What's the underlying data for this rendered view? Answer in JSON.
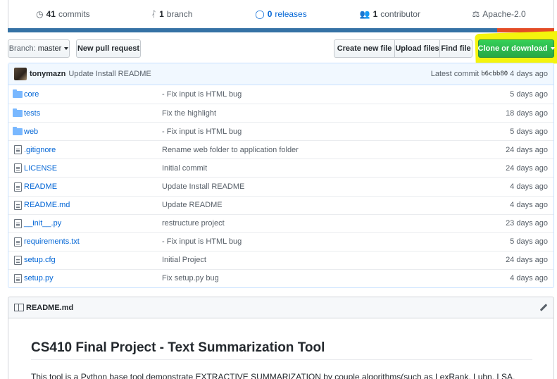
{
  "summary": {
    "commits_count": "41",
    "commits_label": "commits",
    "branch_count": "1",
    "branch_label": "branch",
    "releases_count": "0",
    "releases_label": "releases",
    "contributor_count": "1",
    "contributor_label": "contributor",
    "license": "Apache-2.0"
  },
  "languages": {
    "python_color": "#3572A5",
    "html_color": "#e34c26"
  },
  "toolbar": {
    "branch_label": "Branch:",
    "branch_value": "master",
    "new_pull_request": "New pull request",
    "create_new_file": "Create new file",
    "upload_files": "Upload files",
    "find_file": "Find file",
    "clone_or_download": "Clone or download"
  },
  "latest_commit": {
    "author": "tonymazn",
    "message": "Update Install README",
    "label": "Latest commit",
    "sha": "b6cbb80",
    "age": "4 days ago"
  },
  "files": [
    {
      "type": "folder",
      "icon": "folder-icon",
      "name": "core",
      "message": "- Fix input is HTML bug",
      "age": "5 days ago"
    },
    {
      "type": "folder",
      "icon": "folder-icon",
      "name": "tests",
      "message": "Fix the highlight",
      "age": "18 days ago"
    },
    {
      "type": "folder",
      "icon": "folder-icon",
      "name": "web",
      "message": "- Fix input is HTML bug",
      "age": "5 days ago"
    },
    {
      "type": "file",
      "icon": "file-icon",
      "name": ".gitignore",
      "message": "Rename web folder to application folder",
      "age": "24 days ago"
    },
    {
      "type": "file",
      "icon": "file-icon",
      "name": "LICENSE",
      "message": "Initial commit",
      "age": "24 days ago"
    },
    {
      "type": "file",
      "icon": "file-icon",
      "name": "README",
      "message": "Update Install README",
      "age": "4 days ago"
    },
    {
      "type": "file",
      "icon": "file-icon",
      "name": "README.md",
      "message": "Update README",
      "age": "4 days ago"
    },
    {
      "type": "file",
      "icon": "file-icon",
      "name": "__init__.py",
      "message": "restructure project",
      "age": "23 days ago"
    },
    {
      "type": "file",
      "icon": "file-icon",
      "name": "requirements.txt",
      "message": "- Fix input is HTML bug",
      "age": "5 days ago"
    },
    {
      "type": "file",
      "icon": "file-icon",
      "name": "setup.cfg",
      "message": "Initial Project",
      "age": "24 days ago"
    },
    {
      "type": "file",
      "icon": "file-icon",
      "name": "setup.py",
      "message": "Fix setup.py bug",
      "age": "4 days ago"
    }
  ],
  "readme": {
    "filename": "README.md",
    "heading": "CS410 Final Project - Text Summarization Tool",
    "intro": "This tool is a Python base tool demonstrate EXTRACTIVE SUMMARIZATION by couple algorithms(such as LexRank, Luhn, LSA,"
  },
  "colors": {
    "link": "#0366d6",
    "green_button": "#28a745",
    "highlight": "#f3f300"
  }
}
